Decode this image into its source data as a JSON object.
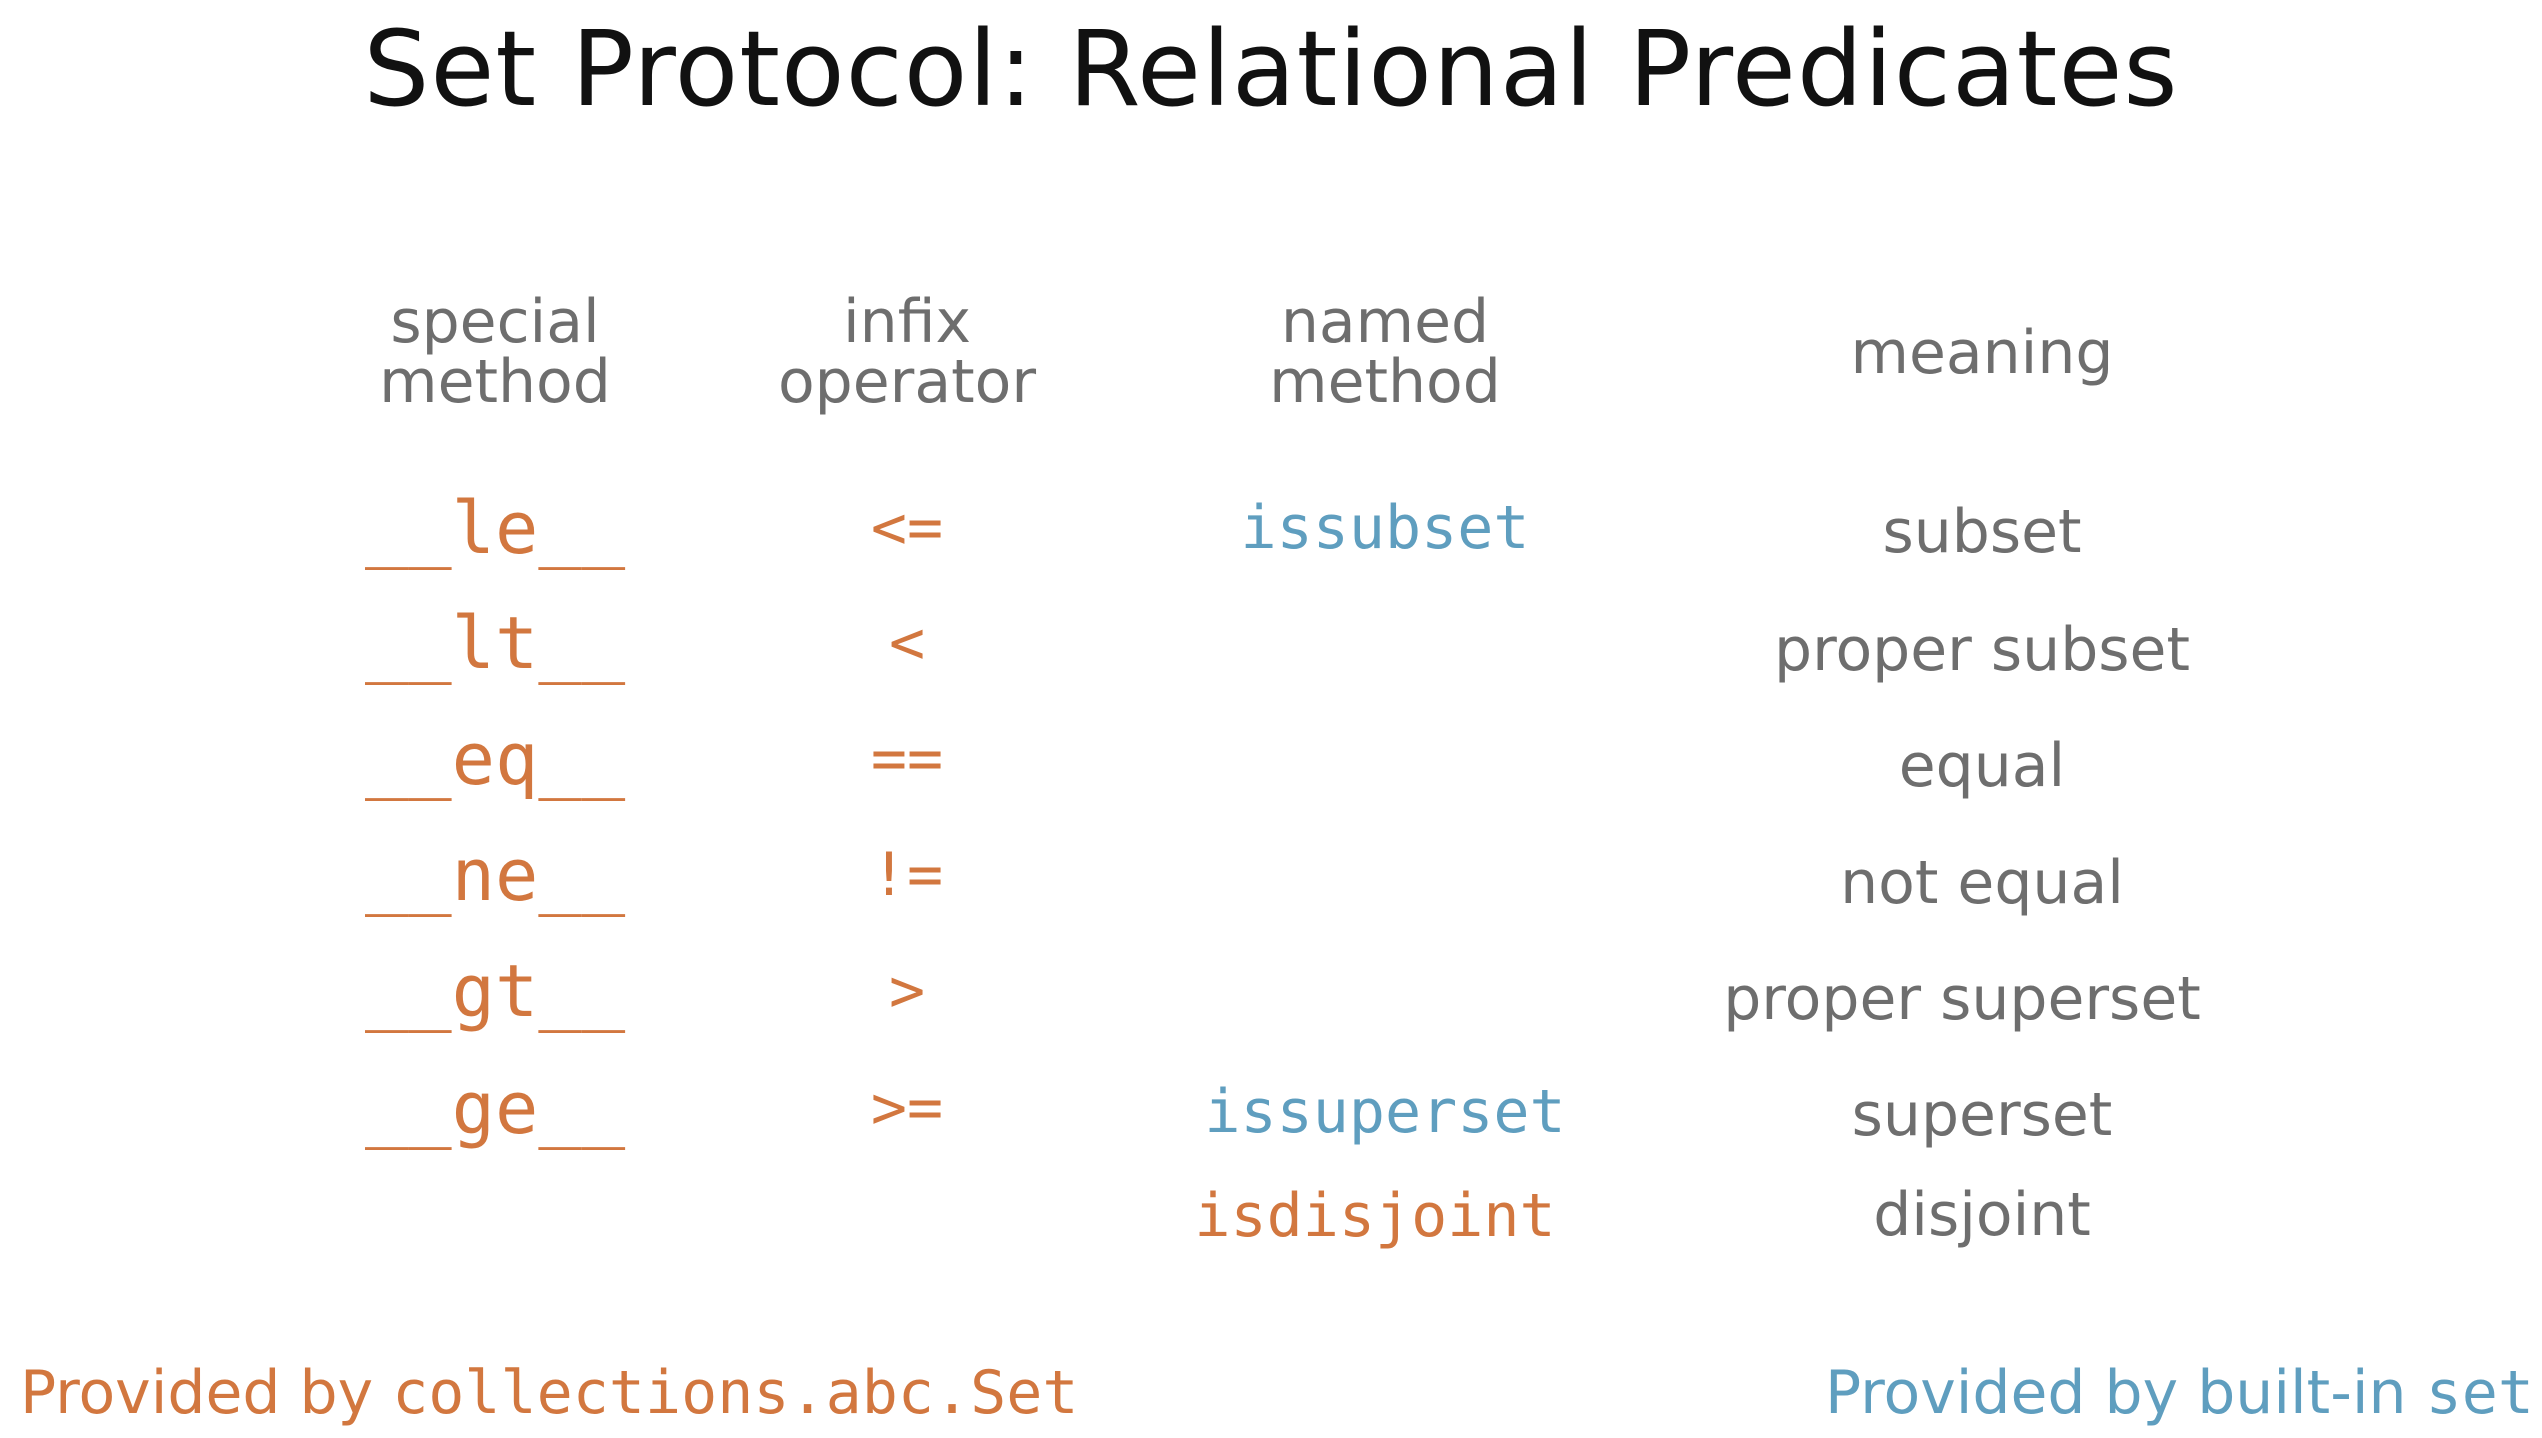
{
  "title": "Set Protocol: Relational Predicates",
  "headers": {
    "special_line1": "special",
    "special_line2": "method",
    "infix_line1": "infix",
    "infix_line2": "operator",
    "named_line1": "named",
    "named_line2": "method",
    "meaning": "meaning"
  },
  "rows": [
    {
      "special": "__le__",
      "infix": "<=",
      "named": "issubset",
      "meaning": "subset"
    },
    {
      "special": "__lt__",
      "infix": "<",
      "named": "",
      "meaning": "proper subset"
    },
    {
      "special": "__eq__",
      "infix": "==",
      "named": "",
      "meaning": "equal"
    },
    {
      "special": "__ne__",
      "infix": "!=",
      "named": "",
      "meaning": "not equal"
    },
    {
      "special": "__gt__",
      "infix": ">",
      "named": "",
      "meaning": "proper superset"
    },
    {
      "special": "__ge__",
      "infix": ">=",
      "named": "issuperset",
      "meaning": "superset"
    },
    {
      "special": "",
      "infix": "",
      "named": "isdisjoint",
      "meaning": "disjoint"
    }
  ],
  "footer": {
    "left_prefix": "Provided by ",
    "left_code": "collections.abc.Set",
    "right_prefix": "Provided by built-in ",
    "right_code": "set"
  },
  "colors": {
    "abc_set": "#d2773f",
    "builtin_set": "#5f9ebf",
    "text_grey": "#6e6e6e"
  }
}
